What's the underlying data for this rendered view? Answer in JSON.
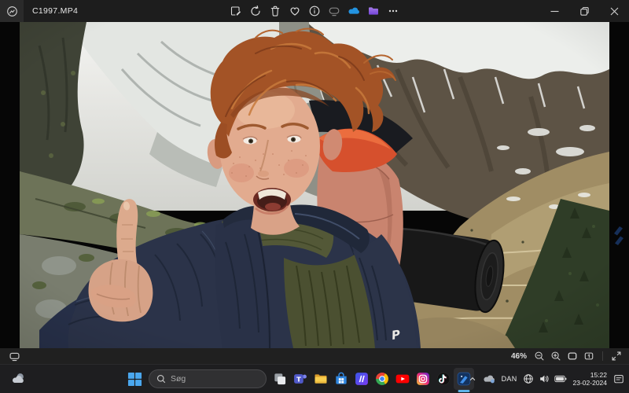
{
  "window": {
    "title": "C1997.MP4",
    "app_icon": "photos-logo-icon",
    "controls": [
      "minimize-icon",
      "restore-icon",
      "close-icon"
    ]
  },
  "toolbar": {
    "icons": [
      "edit-image-icon",
      "rotate-icon",
      "delete-icon",
      "favorite-icon",
      "info-icon",
      "slideshow-icon",
      "onedrive-icon",
      "folder-icon",
      "more-icon"
    ]
  },
  "viewer": {
    "zoom_level": "46%",
    "jacket_logo": "P",
    "statusbar_icons": [
      "filmstrip-icon",
      "zoom-out-icon",
      "zoom-in-icon",
      "fit-to-window-icon",
      "actual-size-icon",
      "fullscreen-icon"
    ],
    "watermark_icon": "blue-s-logo"
  },
  "taskbar": {
    "widgets_icon": "weather-cloud-icon",
    "start_icon": "windows-start-icon",
    "search_placeholder": "Søg",
    "app_icons": [
      "task-view-icon",
      "teams-icon",
      "file-explorer-icon",
      "store-icon",
      "medal-icon",
      "chrome-icon",
      "youtube-icon",
      "instagram-icon",
      "tiktok-icon",
      "photos-icon"
    ],
    "active_app": "photos",
    "tray": {
      "chevron": "chevron-up-icon",
      "onedrive": "onedrive-tray-icon",
      "language": "DAN",
      "icons": [
        "network-icon",
        "volume-icon",
        "battery-icon"
      ],
      "time": "15:22",
      "date": "23-02-2024",
      "notification": "notification-icon"
    }
  },
  "photo": {
    "colors": {
      "jacket_navy": "#2b3349",
      "hair_copper": "#a35326",
      "backpack_orange": "#d6502d",
      "backpack_salmon": "#c9846f",
      "accent_blue": "#5fb3e8"
    }
  }
}
